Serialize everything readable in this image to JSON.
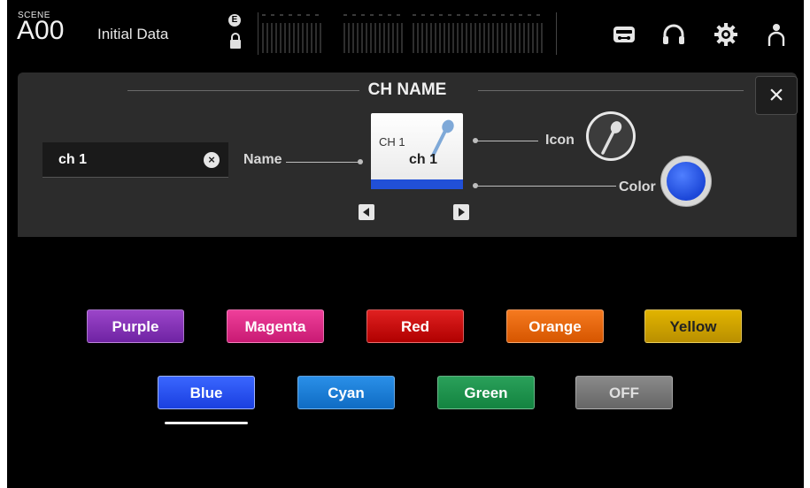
{
  "header": {
    "scene_label": "SCENE",
    "scene_number": "A00",
    "scene_title": "Initial Data",
    "edit_badge": "E"
  },
  "panel": {
    "title": "CH NAME",
    "close_label": "×",
    "name_value": "ch 1",
    "clear_label": "×",
    "name_label": "Name",
    "icon_label": "Icon",
    "color_label": "Color",
    "card_channel": "CH 1",
    "card_name": "ch 1",
    "selected_color": "#1c47d8"
  },
  "colors": {
    "row1": [
      "Purple",
      "Magenta",
      "Red",
      "Orange",
      "Yellow"
    ],
    "row2": [
      "Blue",
      "Cyan",
      "Green",
      "OFF"
    ],
    "selected": "Blue"
  },
  "icons": {
    "top_bar": [
      "recorder-icon",
      "headphones-icon",
      "gear-icon",
      "user-icon"
    ],
    "channel": "microphone-icon"
  }
}
